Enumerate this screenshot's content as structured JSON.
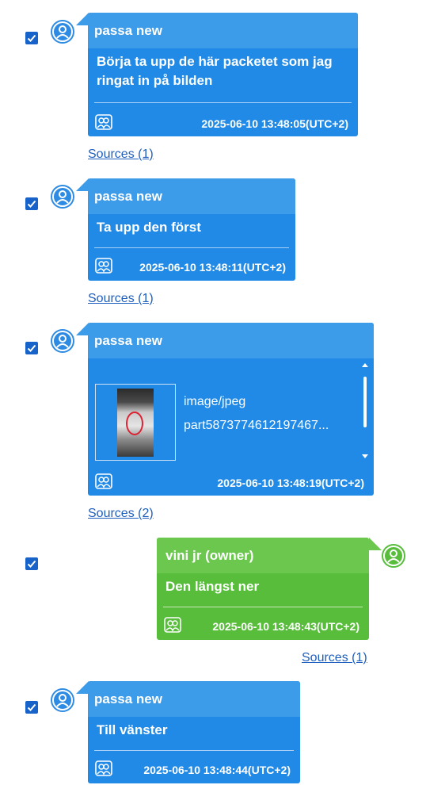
{
  "messages": [
    {
      "sender": "passa new",
      "text_lines": [
        "Börja ta upp de här packetet som jag",
        "ringat in på bilden"
      ],
      "timestamp": "2025-06-10 13:48:05(UTC+2)",
      "sources": "Sources (1)",
      "checked": true
    },
    {
      "sender": "passa new",
      "text_lines": [
        "Ta upp den först"
      ],
      "timestamp": "2025-06-10 13:48:11(UTC+2)",
      "sources": "Sources (1)",
      "checked": true
    },
    {
      "sender": "passa new",
      "attachment": {
        "type": "image/jpeg",
        "name": "part5873774612197467..."
      },
      "timestamp": "2025-06-10 13:48:19(UTC+2)",
      "sources": "Sources (2)",
      "checked": true
    },
    {
      "sender": "vini jr (owner)",
      "text_lines": [
        "Den längst ner"
      ],
      "timestamp": "2025-06-10 13:48:43(UTC+2)",
      "sources": "Sources (1)",
      "checked": true
    },
    {
      "sender": "passa new",
      "text_lines": [
        "Till vänster"
      ],
      "timestamp": "2025-06-10 13:48:44(UTC+2)",
      "sources": "",
      "checked": true
    }
  ],
  "colors": {
    "blue_bubble": "#218ae6",
    "blue_header": "#3d9ce9",
    "green_bubble": "#57bd3b",
    "green_header": "#6cc74e",
    "checkbox": "#1763c9",
    "link": "#1f5fbf"
  },
  "icons": {
    "avatar": "user-circle-icon",
    "group": "group-icon",
    "check": "checkmark-icon"
  }
}
